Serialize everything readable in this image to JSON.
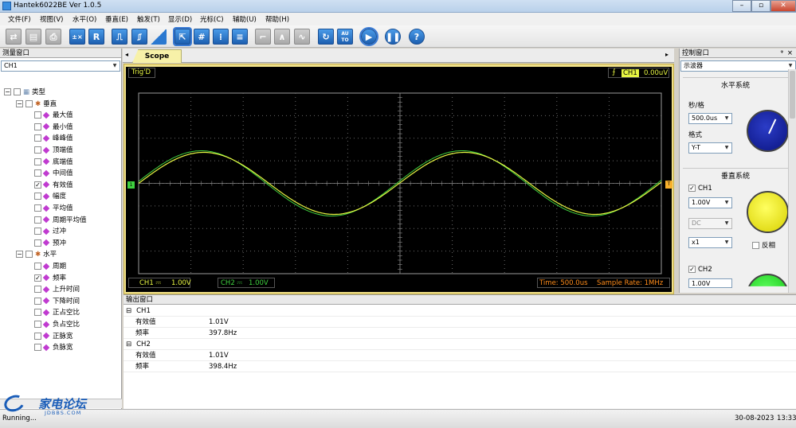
{
  "window": {
    "title": "Hantek6022BE Ver 1.0.5"
  },
  "menu": [
    "文件(F)",
    "视图(V)",
    "水平(O)",
    "垂直(E)",
    "触发(T)",
    "显示(D)",
    "光标(C)",
    "辅助(U)",
    "帮助(H)"
  ],
  "toolbar": {
    "r_label": "R",
    "auto_label": "AU\nTO",
    "help_label": "?"
  },
  "measure_panel": {
    "title": "测量窗口",
    "channel": "CH1",
    "root": "类型",
    "vertical_group": "垂直",
    "vertical_items": [
      {
        "label": "最大值",
        "checked": false
      },
      {
        "label": "最小值",
        "checked": false
      },
      {
        "label": "峰峰值",
        "checked": false
      },
      {
        "label": "顶端值",
        "checked": false
      },
      {
        "label": "底端值",
        "checked": false
      },
      {
        "label": "中间值",
        "checked": false
      },
      {
        "label": "有效值",
        "checked": true
      },
      {
        "label": "幅度",
        "checked": false
      },
      {
        "label": "平均值",
        "checked": false
      },
      {
        "label": "周期平均值",
        "checked": false
      },
      {
        "label": "过冲",
        "checked": false
      },
      {
        "label": "预冲",
        "checked": false
      }
    ],
    "horizontal_group": "水平",
    "horizontal_items": [
      {
        "label": "周期",
        "checked": false
      },
      {
        "label": "频率",
        "checked": true
      },
      {
        "label": "上升时间",
        "checked": false
      },
      {
        "label": "下降时间",
        "checked": false
      },
      {
        "label": "正占空比",
        "checked": false
      },
      {
        "label": "负占空比",
        "checked": false
      },
      {
        "label": "正脉宽",
        "checked": false
      },
      {
        "label": "负脉宽",
        "checked": false
      }
    ]
  },
  "scope": {
    "tab": "Scope",
    "trig_status": "Trig'D",
    "trig_channel": "CH1",
    "trig_level": "0.00uV",
    "ch1_scale_label": "CH1 ⎓",
    "ch1_scale": "1.00V",
    "ch2_scale_label": "CH2 ⎓",
    "ch2_scale": "1.00V",
    "time_base": "Time: 500.0us",
    "sample_rate": "Sample Rate: 1MHz",
    "ch1_marker": "1",
    "trig_marker": "T",
    "colors": {
      "ch1": "#e6f542",
      "ch2": "#3fd13f",
      "grid": "#6a6a6a",
      "text_orange": "#ff8c1a"
    }
  },
  "control_panel": {
    "title": "控制窗口",
    "mode": "示波器",
    "horizontal_title": "水平系统",
    "sec_div_label": "秒/格",
    "sec_div_value": "500.0us",
    "format_label": "格式",
    "format_value": "Y-T",
    "vertical_title": "垂直系统",
    "ch1_label": "CH1",
    "ch1_volts": "1.00V",
    "ch1_coupling": "DC",
    "ch1_probe": "x1",
    "invert_label": "反相",
    "ch2_label": "CH2",
    "ch2_volts": "1.00V",
    "pin_label": "ᵠ",
    "close_label": "×"
  },
  "output_panel": {
    "title": "输出窗口",
    "groups": [
      {
        "name": "CH1",
        "rows": [
          {
            "k": "有效值",
            "v": "1.01V"
          },
          {
            "k": "频率",
            "v": "397.8Hz"
          }
        ]
      },
      {
        "name": "CH2",
        "rows": [
          {
            "k": "有效值",
            "v": "1.01V"
          },
          {
            "k": "频率",
            "v": "398.4Hz"
          }
        ]
      }
    ]
  },
  "status": {
    "text": "Running...",
    "date": "30-08-2023",
    "time": "13:33",
    "logo_text": "家电论坛",
    "logo_sub": "JDBBS.COM"
  }
}
